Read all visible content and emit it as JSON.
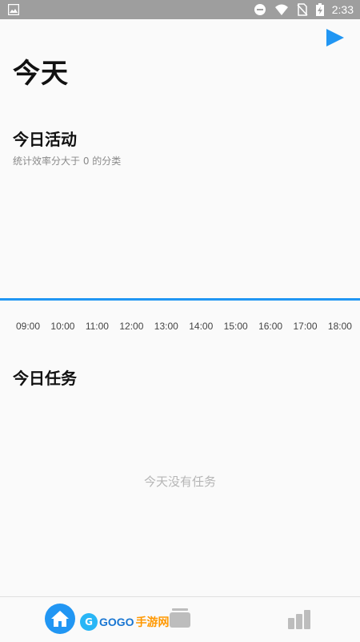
{
  "status_bar": {
    "time": "2:33"
  },
  "header": {
    "title": "今天"
  },
  "activity": {
    "title": "今日活动",
    "subtitle": "统计效率分大于 0 的分类",
    "times": [
      "09:00",
      "10:00",
      "11:00",
      "12:00",
      "13:00",
      "14:00",
      "15:00",
      "16:00",
      "17:00",
      "18:00"
    ]
  },
  "tasks": {
    "title": "今日任务",
    "empty": "今天没有任务"
  },
  "watermark": {
    "brand": "GOGO",
    "suffix": "手游网"
  },
  "colors": {
    "accent": "#2196f3",
    "status_bar": "#9e9e9e"
  }
}
